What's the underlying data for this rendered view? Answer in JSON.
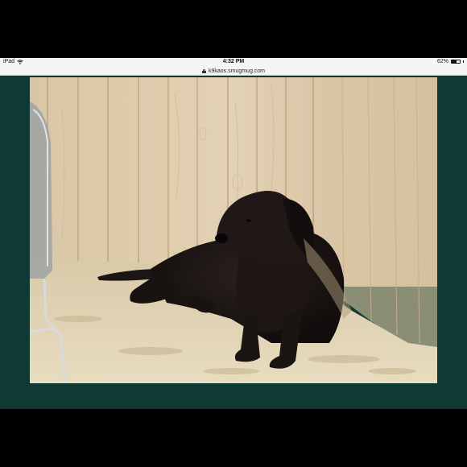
{
  "status_bar": {
    "device": "iPad",
    "time": "4:32 PM",
    "battery": "62%",
    "battery_level": 0.62,
    "wifi_icon": "wifi-icon",
    "battery_icon": "battery-icon"
  },
  "url_bar": {
    "url": "k9kaos.smugmug.com",
    "lock_icon": "lock-icon"
  },
  "colors": {
    "page_background": "#0e3a33",
    "status_bar": "#f5f5f5"
  }
}
